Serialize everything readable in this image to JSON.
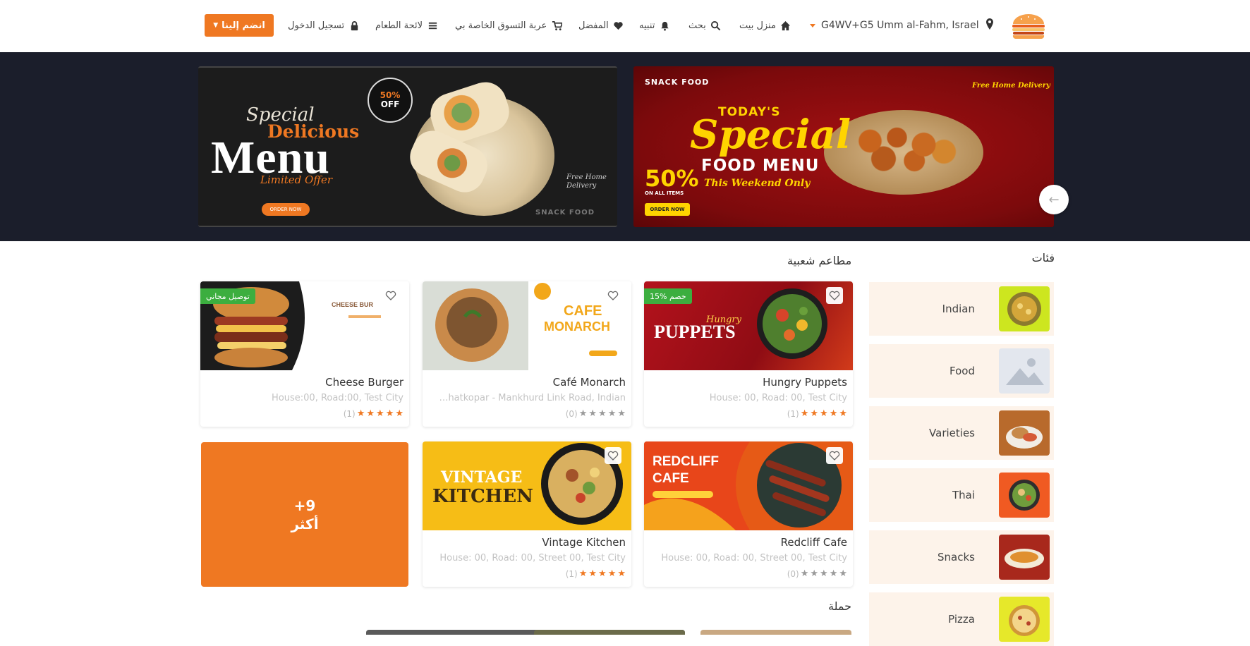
{
  "header": {
    "join_label": "انضم إلينا",
    "nav": [
      {
        "icon": "lock-icon",
        "label": "تسجيل الدخول"
      },
      {
        "icon": "menu-list-icon",
        "label": "لائحة الطعام"
      },
      {
        "icon": "cart-icon",
        "label": "عربة التسوق الخاصة بي"
      },
      {
        "icon": "heart-icon",
        "label": "المفضل"
      },
      {
        "icon": "bell-icon",
        "label": "تنبيه"
      },
      {
        "icon": "search-icon",
        "label": "بحث"
      },
      {
        "icon": "home-icon",
        "label": "منزل بيت"
      }
    ],
    "location": "G4WV+G5 Umm al-Fahm, Israel",
    "accent": "#ef7822"
  },
  "banners": [
    {
      "special": "Special",
      "delicious": "Delicious",
      "menu": "Menu",
      "limited": "Limited Offer",
      "offer_top": "50%",
      "offer_bottom": "OFF",
      "order": "ORDER NOW",
      "script": "Free Home Delivery",
      "brand": "SNACK FOOD"
    },
    {
      "brand": "SNACK FOOD",
      "today": "TODAY'S",
      "special": "Special",
      "food_menu": "FOOD MENU",
      "weekend": "This Weekend Only",
      "fifty": "50%",
      "off": "ON ALL ITEMS",
      "order": "ORDER NOW",
      "free": "Free Home Delivery"
    }
  ],
  "categories": {
    "title": "فئات",
    "items": [
      {
        "label": "Indian"
      },
      {
        "label": "Food"
      },
      {
        "label": "Varieties"
      },
      {
        "label": "Thai"
      },
      {
        "label": "Snacks"
      },
      {
        "label": "Pizza"
      }
    ]
  },
  "popular": {
    "title": "مطاعم شعبية",
    "restaurants": [
      {
        "name": "Cheese Burger",
        "address": "House:00, Road:00, Test City",
        "rating": 5,
        "count": "(1)",
        "badge": "توصيل مجاني"
      },
      {
        "name": "Café Monarch",
        "address": "Ghatkopar - Mankhurd Link Road, Indian ...",
        "rating": 0,
        "count": "(0)",
        "badge": ""
      },
      {
        "name": "Hungry Puppets",
        "address": "House: 00, Road: 00, Test City",
        "rating": 5,
        "count": "(1)",
        "badge": "15% خصم"
      },
      {
        "name": "Vintage Kitchen",
        "address": "House: 00, Road: 00, Street 00, Test City",
        "rating": 5,
        "count": "(1)",
        "badge": ""
      },
      {
        "name": "Redcliff Cafe",
        "address": "House: 00, Road: 00, Street 00, Test City",
        "rating": 0,
        "count": "(0)",
        "badge": ""
      }
    ],
    "more_count": "+9",
    "more_label": "أكثر"
  },
  "campaign": {
    "title": "حملة"
  }
}
